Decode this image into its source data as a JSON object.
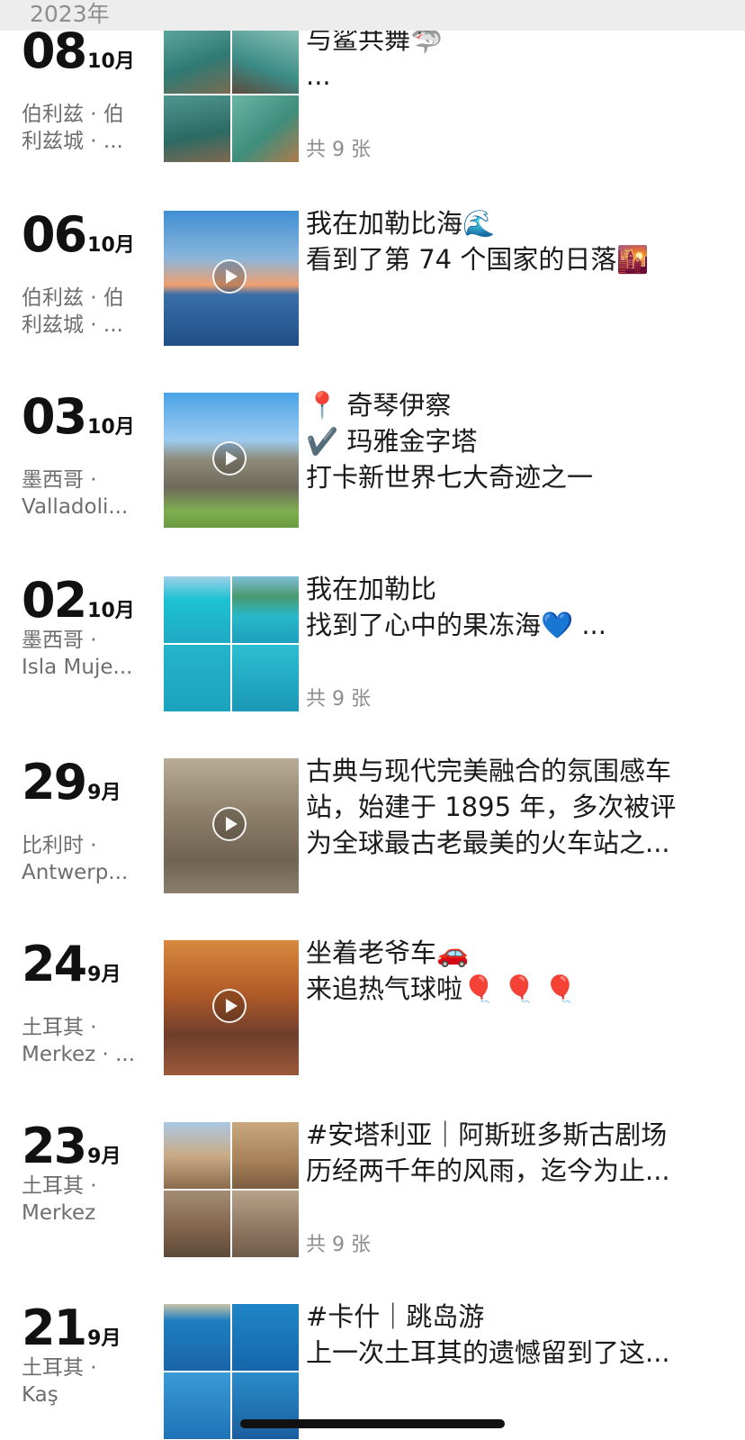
{
  "header": {
    "year": "2023年"
  },
  "posts": [
    {
      "day": "08",
      "month": "10月",
      "location": [
        "伯利兹 · 伯",
        "利兹城 · ..."
      ],
      "media": "grid",
      "video": false,
      "text": [
        "与鲨共舞🦈",
        "..."
      ],
      "count": "共 9 张"
    },
    {
      "day": "06",
      "month": "10月",
      "location": [
        "伯利兹 · 伯",
        "利兹城 · ..."
      ],
      "media": "single",
      "video": true,
      "text": [
        "我在加勒比海🌊",
        "看到了第 74 个国家的日落🌇"
      ],
      "count": ""
    },
    {
      "day": "03",
      "month": "10月",
      "location": [
        "墨西哥 ·",
        "Valladoli..."
      ],
      "media": "single",
      "video": true,
      "text": [
        "📍 奇琴伊察",
        "✔️ 玛雅金字塔",
        "打卡新世界七大奇迹之一"
      ],
      "count": ""
    },
    {
      "day": "02",
      "month": "10月",
      "location": [
        "墨西哥 ·",
        "Isla Muje..."
      ],
      "media": "grid",
      "video": false,
      "text": [
        "我在加勒比",
        "找到了心中的果冻海💙 ..."
      ],
      "count": "共 9 张"
    },
    {
      "day": "29",
      "month": "9月",
      "location": [
        "比利时 ·",
        "Antwerp..."
      ],
      "media": "single",
      "video": true,
      "text": [
        "古典与现代完美融合的氛围感车",
        "站，始建于 1895 年，多次被评",
        "为全球最古老最美的火车站之..."
      ],
      "count": ""
    },
    {
      "day": "24",
      "month": "9月",
      "location": [
        "土耳其 ·",
        "Merkez · ..."
      ],
      "media": "single",
      "video": true,
      "text": [
        "坐着老爷车🚗",
        "来追热气球啦🎈 🎈 🎈"
      ],
      "count": ""
    },
    {
      "day": "23",
      "month": "9月",
      "location": [
        "土耳其 ·",
        "Merkez"
      ],
      "media": "grid",
      "video": false,
      "text": [
        "#安塔利亚｜阿斯班多斯古剧场",
        "历经两千年的风雨，迄今为止..."
      ],
      "count": "共 9 张"
    },
    {
      "day": "21",
      "month": "9月",
      "location": [
        "土耳其 ·",
        "Kaş"
      ],
      "media": "grid",
      "video": false,
      "text": [
        "#卡什｜跳岛游",
        "上一次土耳其的遗憾留到了这..."
      ],
      "count": ""
    }
  ]
}
